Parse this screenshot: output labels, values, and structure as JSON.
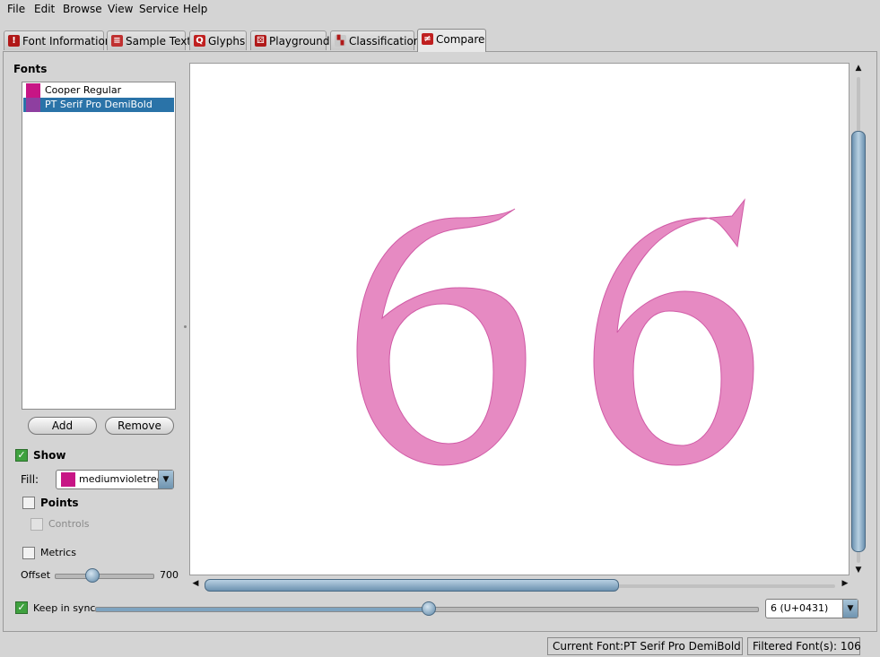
{
  "menu": [
    "File",
    "Edit",
    "Browse",
    "View",
    "Service",
    "Help"
  ],
  "tabs": [
    "Font Information",
    "Sample Text",
    "Glyphs",
    "Playground",
    "Classification",
    "Compare"
  ],
  "active_tab": "Compare",
  "sidebar": {
    "fonts_heading": "Fonts",
    "fonts": [
      {
        "name": "Cooper Regular",
        "color": "#c71585",
        "selected": false
      },
      {
        "name": "PT Serif Pro DemiBold",
        "color": "#8e3fa0",
        "selected": true
      }
    ],
    "add_label": "Add",
    "remove_label": "Remove",
    "show_label": "Show",
    "show_checked": true,
    "fill_label": "Fill:",
    "fill_value": "mediumvioletred",
    "fill_color": "#c71585",
    "points_label": "Points",
    "controls_label": "Controls",
    "metrics_label": "Metrics",
    "offset_label": "Offset",
    "offset_value": "700"
  },
  "bottom": {
    "keep_in_sync_label": "Keep in sync",
    "keep_in_sync_checked": true,
    "glyph_select": "6  (U+0431)"
  },
  "status": {
    "current_font": "Current Font:PT Serif Pro DemiBold",
    "filtered": "Filtered Font(s): 106"
  },
  "colors": {
    "glyph_fill": "#e68ac2",
    "glyph_stroke": "#d05aa6",
    "selection": "#2a73a8",
    "accent": "#6c92b0"
  }
}
